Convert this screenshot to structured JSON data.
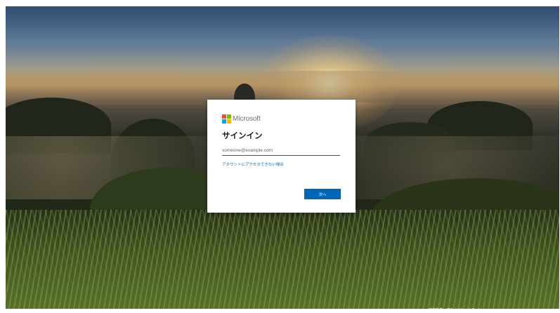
{
  "brand": {
    "name": "Microsoft",
    "logo_colors": [
      "#f25022",
      "#7fba00",
      "#00a4ef",
      "#ffb900"
    ]
  },
  "signin": {
    "title": "サインイン",
    "email_placeholder": "someone@example.com",
    "email_value": "",
    "no_account_link": "アカウントにアクセスできない場合",
    "next_label": "次へ"
  },
  "footer": {
    "text": "使用条件　プライバシーと Cookie　..."
  },
  "colors": {
    "accent": "#0067b8",
    "card": "#ffffff"
  }
}
